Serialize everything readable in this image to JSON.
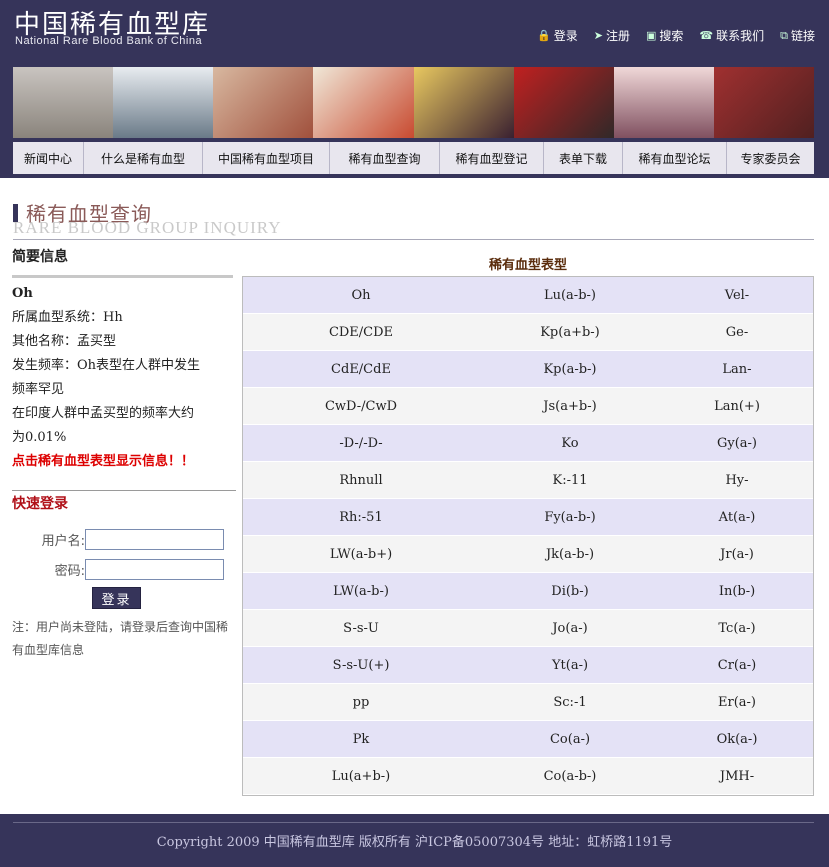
{
  "header": {
    "logo_cn": "中国稀有血型库",
    "logo_en": "National Rare Blood Bank of China",
    "top_links": [
      {
        "label": "登录",
        "icon": "lock-icon",
        "glyph": "🔒"
      },
      {
        "label": "注册",
        "icon": "pointer-icon",
        "glyph": "➤"
      },
      {
        "label": "搜索",
        "icon": "search-icon",
        "glyph": "▣"
      },
      {
        "label": "联系我们",
        "icon": "contact-icon",
        "glyph": "☎"
      },
      {
        "label": "链接",
        "icon": "link-icon",
        "glyph": "⧉"
      }
    ]
  },
  "nav": [
    {
      "label": "新闻中心"
    },
    {
      "label": "什么是稀有血型"
    },
    {
      "label": "中国稀有血型项目"
    },
    {
      "label": "稀有血型查询"
    },
    {
      "label": "稀有血型登记"
    },
    {
      "label": "表单下载"
    },
    {
      "label": "稀有血型论坛"
    },
    {
      "label": "专家委员会"
    }
  ],
  "section": {
    "title_cn": "稀有血型查询",
    "title_en": "RARE BLOOD GROUP INQUIRY"
  },
  "summary": {
    "heading": "简要信息",
    "name": "Oh",
    "system": "所属血型系统：Hh",
    "alias": "其他名称：孟买型",
    "freq1": "发生频率：Oh表型在人群中发生",
    "freq2": "频率罕见",
    "freq3": "在印度人群中孟买型的频率大约",
    "freq4": "为0.01%",
    "hint": "点击稀有血型表型显示信息！！"
  },
  "quick_login": {
    "heading": "快速登录",
    "username_label": "用户名:",
    "password_label": "密码:",
    "button": "登录",
    "note": "注：用户尚未登陆，请登录后查询中国稀有血型库信息"
  },
  "table": {
    "title": "稀有血型表型",
    "rows": [
      [
        "Oh",
        "Lu(a-b-)",
        "Vel-"
      ],
      [
        "CDE/CDE",
        "Kp(a+b-)",
        "Ge-"
      ],
      [
        "CdE/CdE",
        "Kp(a-b-)",
        "Lan-"
      ],
      [
        "CwD-/CwD",
        "Js(a+b-)",
        "Lan(+)"
      ],
      [
        "-D-/-D-",
        "Ko",
        "Gy(a-)"
      ],
      [
        "Rhnull",
        "K:-11",
        "Hy-"
      ],
      [
        "Rh:-51",
        "Fy(a-b-)",
        "At(a-)"
      ],
      [
        "LW(a-b+)",
        "Jk(a-b-)",
        "Jr(a-)"
      ],
      [
        "LW(a-b-)",
        "Di(b-)",
        "In(b-)"
      ],
      [
        "S-s-U",
        "Jo(a-)",
        "Tc(a-)"
      ],
      [
        "S-s-U(+)",
        "Yt(a-)",
        "Cr(a-)"
      ],
      [
        "pp",
        "Sc:-1",
        "Er(a-)"
      ],
      [
        "Pk",
        "Co(a-)",
        "Ok(a-)"
      ],
      [
        "Lu(a+b-)",
        "Co(a-b-)",
        "JMH-"
      ]
    ]
  },
  "footer": {
    "text": "Copyright 2009 中国稀有血型库  版权所有  沪ICP备05007304号  地址：虹桥路1191号"
  },
  "colors": {
    "header_bg": "#36345a",
    "row_odd": "#e4e2f6",
    "row_even": "#f4f4f4",
    "hint_red": "#dd0000"
  }
}
